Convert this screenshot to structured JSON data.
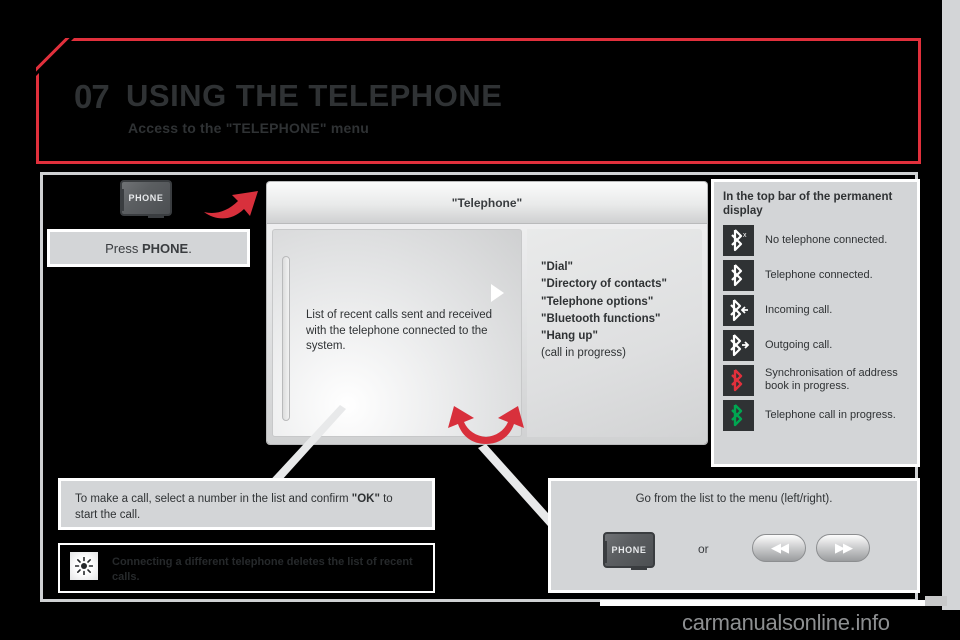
{
  "header": {
    "chapter_number": "07",
    "title": "USING THE TELEPHONE",
    "subtitle": "Access to the \"TELEPHONE\" menu",
    "accent_color": "#e1303c"
  },
  "left": {
    "phone_key_label": "PHONE",
    "press_phone_caption": "Press PHONE.",
    "press_phone_prefix": "Press ",
    "press_phone_bold": "PHONE",
    "press_phone_suffix": "."
  },
  "display": {
    "title": "\"Telephone\"",
    "left_pane_text": "List of recent calls sent and received with the telephone connected to the system.",
    "menu_items": [
      "\"Dial\"",
      "\"Directory of contacts\"",
      "\"Telephone options\"",
      "\"Bluetooth functions\"",
      "\"Hang up\"",
      "(call in progress)"
    ]
  },
  "bluetooth_panel": {
    "heading": "In the top bar of the permanent display",
    "rows": [
      {
        "icon": "bluetooth-no-connection-icon",
        "label": "No telephone connected.",
        "color": "#ffffff",
        "mark": "x"
      },
      {
        "icon": "bluetooth-connected-icon",
        "label": "Telephone connected.",
        "color": "#ffffff",
        "mark": ""
      },
      {
        "icon": "bluetooth-incoming-call-icon",
        "label": "Incoming call.",
        "color": "#ffffff",
        "mark": "left"
      },
      {
        "icon": "bluetooth-outgoing-call-icon",
        "label": "Outgoing call.",
        "color": "#ffffff",
        "mark": "right"
      },
      {
        "icon": "bluetooth-sync-icon",
        "label": "Synchronisation of address book in progress.",
        "color": "#e1303c",
        "mark": ""
      },
      {
        "icon": "bluetooth-call-in-progress-icon",
        "label": "Telephone call in progress.",
        "color": "#00a651",
        "mark": ""
      }
    ]
  },
  "bottom_left": {
    "make_call_text_1": "To make a call, select a number in the list and confirm ",
    "make_call_bold": "\"OK\"",
    "make_call_text_2": " to start the call.",
    "tip_text": "Connecting a different telephone deletes the list of recent calls."
  },
  "bottom_right": {
    "title": "Go from the list to the menu (left/right).",
    "phone_key_label": "PHONE",
    "or_label": "or",
    "seek_prev_glyph": "◀◀",
    "seek_next_glyph": "▶▶"
  },
  "watermark": {
    "text": "carmanualsonline.info"
  }
}
